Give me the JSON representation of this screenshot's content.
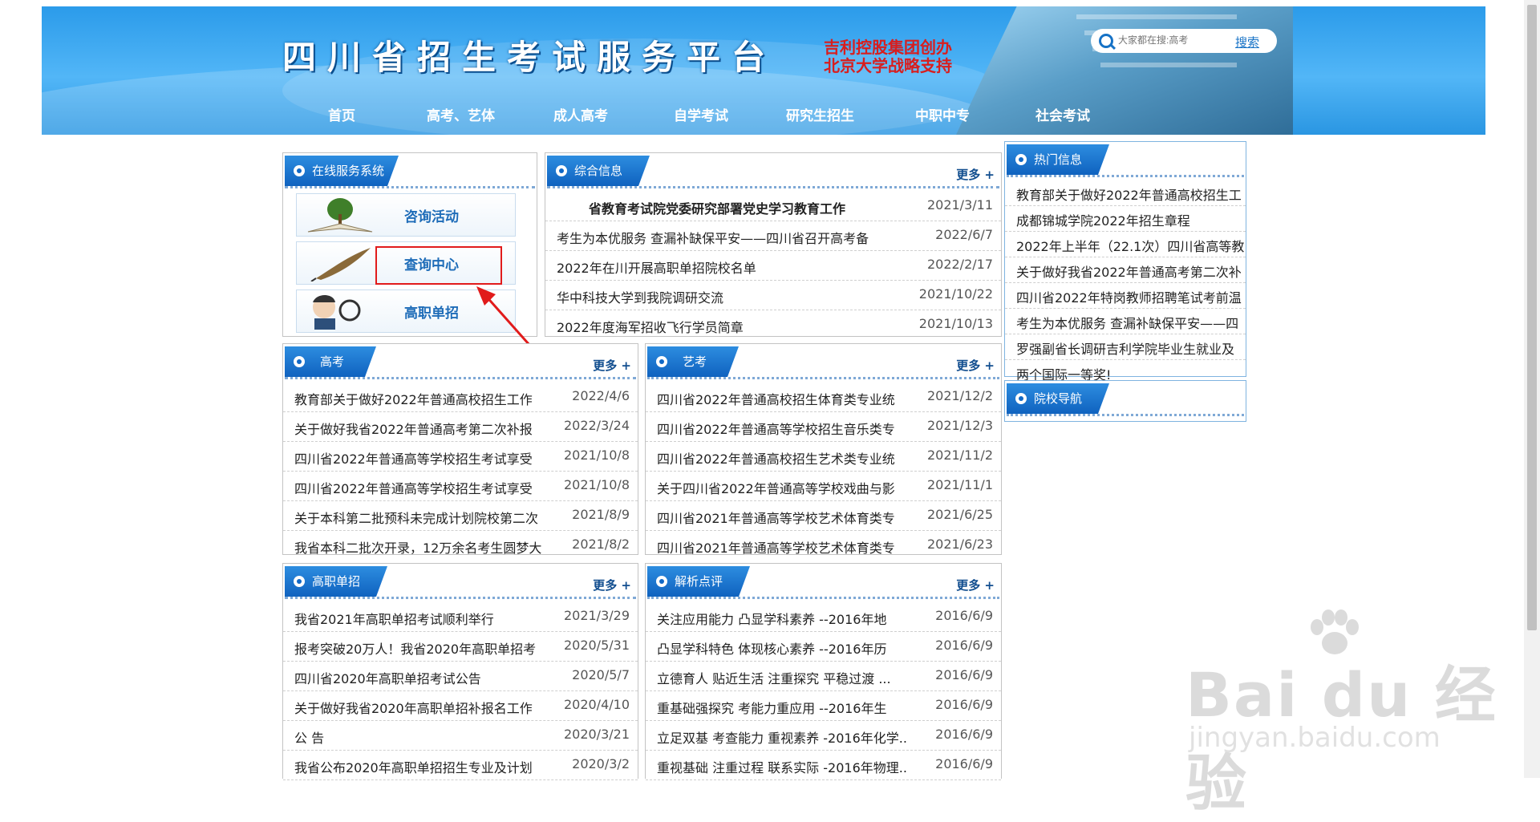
{
  "header": {
    "title": "四川省招生考试服务平台",
    "sponsor_line1": "吉利控股集团创办",
    "sponsor_line2": "北京大学战略支持",
    "search_placeholder": "大家都在搜:高考",
    "search_link": "搜索"
  },
  "nav": [
    "首页",
    "高考、艺体",
    "成人高考",
    "自学考试",
    "研究生招生",
    "中职中专",
    "社会考试"
  ],
  "service": {
    "title": "在线服务系统",
    "items": [
      "咨询活动",
      "查询中心",
      "高职单招"
    ]
  },
  "more_label": "更多 +",
  "general": {
    "title": "综合信息",
    "featured": {
      "title": "省教育考试院党委研究部署党史学习教育工作",
      "date": "2021/3/11"
    },
    "items": [
      {
        "title": "考生为本优服务 查漏补缺保平安——四川省召开高考备",
        "date": "2022/6/7"
      },
      {
        "title": "2022年在川开展高职单招院校名单",
        "date": "2022/2/17"
      },
      {
        "title": "华中科技大学到我院调研交流",
        "date": "2021/10/22"
      },
      {
        "title": "2022年度海军招收飞行学员简章",
        "date": "2021/10/13"
      }
    ]
  },
  "hot": {
    "title": "热门信息",
    "items": [
      "教育部关于做好2022年普通高校招生工",
      "成都锦城学院2022年招生章程",
      "2022年上半年（22.1次）四川省高等教",
      "关于做好我省2022年普通高考第二次补",
      "四川省2022年特岗教师招聘笔试考前温",
      "考生为本优服务 查漏补缺保平安——四",
      "罗强副省长调研吉利学院毕业生就业及",
      "两个国际一等奖!"
    ]
  },
  "nav_panel": {
    "title": "院校导航"
  },
  "gaokao": {
    "title": "高考",
    "items": [
      {
        "title": "教育部关于做好2022年普通高校招生工作",
        "date": "2022/4/6"
      },
      {
        "title": "关于做好我省2022年普通高考第二次补报",
        "date": "2022/3/24"
      },
      {
        "title": "四川省2022年普通高等学校招生考试享受",
        "date": "2021/10/8"
      },
      {
        "title": "四川省2022年普通高等学校招生考试享受",
        "date": "2021/10/8"
      },
      {
        "title": "关于本科第二批预科未完成计划院校第二次",
        "date": "2021/8/9"
      },
      {
        "title": "我省本科二批次开录，12万余名考生圆梦大",
        "date": "2021/8/2"
      }
    ]
  },
  "yikao": {
    "title": "艺考",
    "items": [
      {
        "title": "四川省2022年普通高校招生体育类专业统",
        "date": "2021/12/2"
      },
      {
        "title": "四川省2022年普通高等学校招生音乐类专",
        "date": "2021/12/3"
      },
      {
        "title": "四川省2022年普通高校招生艺术类专业统",
        "date": "2021/11/2"
      },
      {
        "title": "关于四川省2022年普通高等学校戏曲与影",
        "date": "2021/11/1"
      },
      {
        "title": "四川省2021年普通高等学校艺术体育类专",
        "date": "2021/6/25"
      },
      {
        "title": "四川省2021年普通高等学校艺术体育类专",
        "date": "2021/6/23"
      }
    ]
  },
  "danzhao": {
    "title": "高职单招",
    "items": [
      {
        "title": "我省2021年高职单招考试顺利举行",
        "date": "2021/3/29"
      },
      {
        "title": "报考突破20万人！我省2020年高职单招考",
        "date": "2020/5/31"
      },
      {
        "title": "四川省2020年高职单招考试公告",
        "date": "2020/5/7"
      },
      {
        "title": "关于做好我省2020年高职单招补报名工作",
        "date": "2020/4/10"
      },
      {
        "title": "公 告",
        "date": "2020/3/21"
      },
      {
        "title": "我省公布2020年高职单招招生专业及计划",
        "date": "2020/3/2"
      }
    ]
  },
  "jiexi": {
    "title": "解析点评",
    "items": [
      {
        "title": "关注应用能力 凸显学科素养 --2016年地",
        "date": "2016/6/9"
      },
      {
        "title": "凸显学科特色 体现核心素养 --2016年历",
        "date": "2016/6/9"
      },
      {
        "title": "立德育人 贴近生活 注重探究 平稳过渡 ...",
        "date": "2016/6/9"
      },
      {
        "title": "重基础强探究 考能力重应用 --2016年生",
        "date": "2016/6/9"
      },
      {
        "title": "立足双基 考查能力 重视素养 -2016年化学..",
        "date": "2016/6/9"
      },
      {
        "title": "重视基础 注重过程 联系实际 -2016年物理..",
        "date": "2016/6/9"
      }
    ]
  },
  "watermark": {
    "brand": "Bai du 经验",
    "url": "jingyan.baidu.com"
  }
}
